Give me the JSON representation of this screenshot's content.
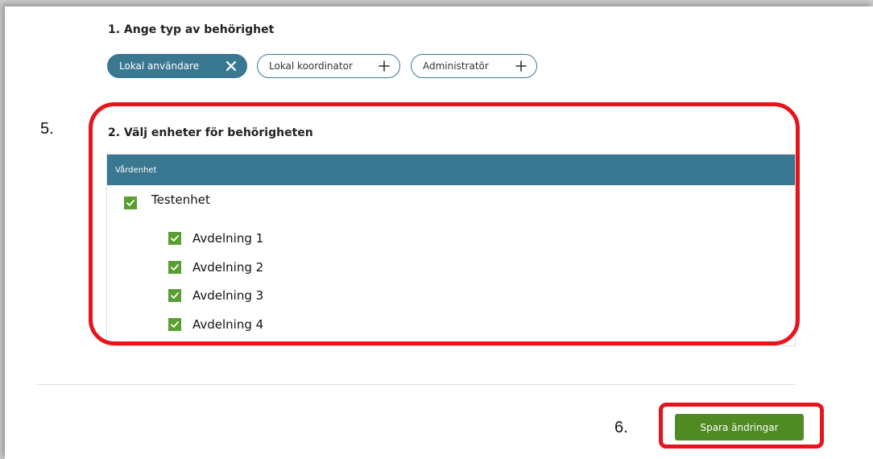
{
  "section1": {
    "title": "1. Ange typ av behörighet",
    "chips": [
      {
        "label": "Lokal användare",
        "selected": true,
        "icon": "close-icon"
      },
      {
        "label": "Lokal koordinator",
        "selected": false,
        "icon": "plus-icon"
      },
      {
        "label": "Administratör",
        "selected": false,
        "icon": "plus-icon"
      }
    ]
  },
  "section2": {
    "title": "2. Välj enheter för behörigheten",
    "column_header": "Vårdenhet",
    "parent_unit": {
      "label": "Testenhet",
      "checked": true
    },
    "children": [
      {
        "label": "Avdelning 1",
        "checked": true
      },
      {
        "label": "Avdelning 2",
        "checked": true
      },
      {
        "label": "Avdelning 3",
        "checked": true
      },
      {
        "label": "Avdelning 4",
        "checked": true
      }
    ]
  },
  "annotations": {
    "step5": "5.",
    "step6": "6."
  },
  "save_button": {
    "label": "Spara ändringar"
  },
  "colors": {
    "accent": "#3a7891",
    "checkbox": "#5a9e32",
    "save": "#4f8a23",
    "highlight": "#e8141b"
  }
}
